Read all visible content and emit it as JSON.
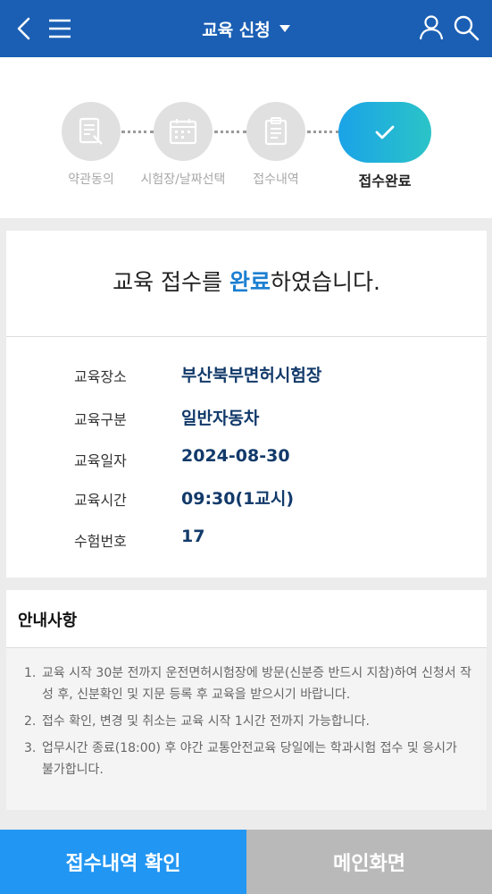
{
  "header": {
    "title": "교육 신청",
    "icons": [
      "back-icon",
      "menu-icon",
      "user-icon",
      "search-icon"
    ]
  },
  "steps": [
    {
      "label": "약관동의",
      "icon": "document-icon",
      "state": "done"
    },
    {
      "label": "시험장/날짜선택",
      "icon": "calendar-icon",
      "state": "done"
    },
    {
      "label": "접수내역",
      "icon": "clipboard-icon",
      "state": "done"
    },
    {
      "label": "접수완료",
      "icon": "check-icon",
      "state": "active"
    }
  ],
  "result": {
    "title_prefix": "교육 접수를 ",
    "title_highlight": "완료",
    "title_suffix": "하였습니다.",
    "rows": [
      {
        "key": "교육장소",
        "value": "부산북부면허시험장"
      },
      {
        "key": "교육구분",
        "value": "일반자동차"
      },
      {
        "key": "교육일자",
        "value": "2024-08-30"
      },
      {
        "key": "교육시간",
        "value": "09:30(1교시)"
      },
      {
        "key": "수험번호",
        "value": "17"
      }
    ]
  },
  "notice": {
    "title": "안내사항",
    "items": [
      {
        "num": "1.",
        "text": "교육 시작 30분 전까지 운전면허시험장에 방문(신분증 반드시 지참)하여 신청서 작성 후, 신분확인 및 지문 등록 후 교육을 받으시기 바랍니다."
      },
      {
        "num": "2.",
        "text": "접수 확인, 변경 및 취소는 교육 시작 1시간 전까지 가능합니다."
      },
      {
        "num": "3.",
        "text": "업무시간 종료(18:00) 후 야간 교통안전교육 당일에는 학과시험 접수 및 응시가 불가합니다."
      }
    ]
  },
  "buttons": {
    "primary": "접수내역 확인",
    "secondary": "메인화면"
  },
  "colors": {
    "header_bg": "#1a5fb4",
    "accent": "#1b7fd1",
    "primary_button": "#2196f3",
    "secondary_button": "#b9b9b9"
  }
}
